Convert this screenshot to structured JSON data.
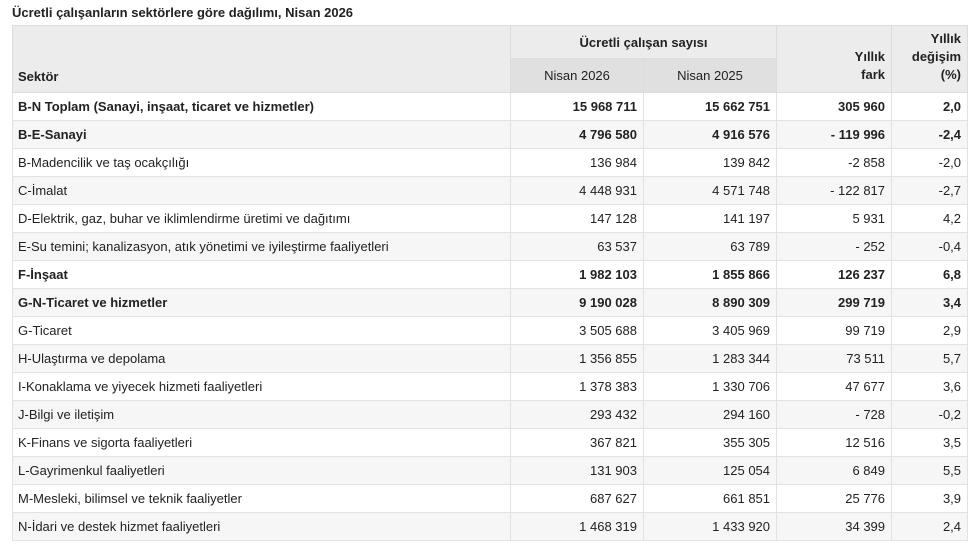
{
  "title": "Ücretli çalışanların sektörlere göre dağılımı, Nisan 2026",
  "header": {
    "sector": "Sektör",
    "group": "Ücretli çalışan sayısı",
    "nisan2026": "Nisan 2026",
    "nisan2025": "Nisan 2025",
    "diff_line1": "Yıllık",
    "diff_line2": "fark",
    "pct_line1": "Yıllık",
    "pct_line2": "değişim",
    "pct_line3": "(%)"
  },
  "rows": [
    {
      "sector": "B-N Toplam (Sanayi, inşaat, ticaret ve hizmetler)",
      "n2026": "15 968 711",
      "n2025": "15 662 751",
      "diff": "305 960",
      "pct": "2,0",
      "bold": true
    },
    {
      "sector": "B-E-Sanayi",
      "n2026": "4 796 580",
      "n2025": "4 916 576",
      "diff": "- 119 996",
      "pct": "-2,4",
      "bold": true
    },
    {
      "sector": "B-Madencilik ve taş ocakçılığı",
      "n2026": "136 984",
      "n2025": "139 842",
      "diff": "-2 858",
      "pct": "-2,0",
      "bold": false
    },
    {
      "sector": "C-İmalat",
      "n2026": "4 448 931",
      "n2025": "4 571 748",
      "diff": "- 122 817",
      "pct": "-2,7",
      "bold": false
    },
    {
      "sector": "D-Elektrik, gaz, buhar ve iklimlendirme üretimi ve dağıtımı",
      "n2026": "147 128",
      "n2025": "141 197",
      "diff": "5 931",
      "pct": "4,2",
      "bold": false
    },
    {
      "sector": "E-Su temini; kanalizasyon, atık yönetimi ve iyileştirme faaliyetleri",
      "n2026": "63 537",
      "n2025": "63 789",
      "diff": "- 252",
      "pct": "-0,4",
      "bold": false
    },
    {
      "sector": "F-İnşaat",
      "n2026": "1 982 103",
      "n2025": "1 855 866",
      "diff": "126 237",
      "pct": "6,8",
      "bold": true
    },
    {
      "sector": "G-N-Ticaret ve hizmetler",
      "n2026": "9 190 028",
      "n2025": "8 890 309",
      "diff": "299 719",
      "pct": "3,4",
      "bold": true
    },
    {
      "sector": "G-Ticaret",
      "n2026": "3 505 688",
      "n2025": "3 405 969",
      "diff": "99 719",
      "pct": "2,9",
      "bold": false
    },
    {
      "sector": "H-Ulaştırma ve depolama",
      "n2026": "1 356 855",
      "n2025": "1 283 344",
      "diff": "73 511",
      "pct": "5,7",
      "bold": false
    },
    {
      "sector": "I-Konaklama ve yiyecek hizmeti faaliyetleri",
      "n2026": "1 378 383",
      "n2025": "1 330 706",
      "diff": "47 677",
      "pct": "3,6",
      "bold": false
    },
    {
      "sector": "J-Bilgi ve iletişim",
      "n2026": "293 432",
      "n2025": "294 160",
      "diff": "- 728",
      "pct": "-0,2",
      "bold": false
    },
    {
      "sector": "K-Finans ve sigorta faaliyetleri",
      "n2026": "367 821",
      "n2025": "355 305",
      "diff": "12 516",
      "pct": "3,5",
      "bold": false
    },
    {
      "sector": "L-Gayrimenkul faaliyetleri",
      "n2026": "131 903",
      "n2025": "125 054",
      "diff": "6 849",
      "pct": "5,5",
      "bold": false
    },
    {
      "sector": "M-Mesleki, bilimsel ve teknik faaliyetler",
      "n2026": "687 627",
      "n2025": "661 851",
      "diff": "25 776",
      "pct": "3,9",
      "bold": false
    },
    {
      "sector": "N-İdari ve destek hizmet faaliyetleri",
      "n2026": "1 468 319",
      "n2025": "1 433 920",
      "diff": "34 399",
      "pct": "2,4",
      "bold": false
    }
  ]
}
